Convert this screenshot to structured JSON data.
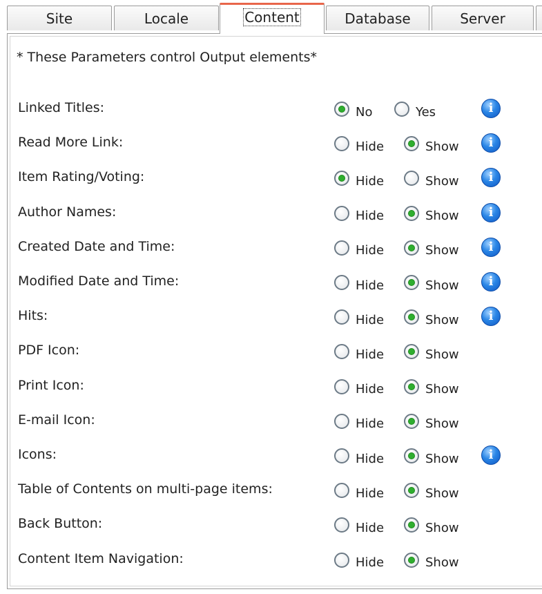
{
  "tabs": [
    "Site",
    "Locale",
    "Content",
    "Database",
    "Server"
  ],
  "intro": "* These Parameters control Output elements*",
  "info_icon_glyph": "i",
  "rows": [
    {
      "label": "Linked Titles:",
      "options": [
        "No",
        "Yes"
      ],
      "selected": 0,
      "info": true
    },
    {
      "label": "Read More Link:",
      "options": [
        "Hide",
        "Show"
      ],
      "selected": 1,
      "info": true
    },
    {
      "label": "Item Rating/Voting:",
      "options": [
        "Hide",
        "Show"
      ],
      "selected": 0,
      "info": true
    },
    {
      "label": "Author Names:",
      "options": [
        "Hide",
        "Show"
      ],
      "selected": 1,
      "info": true
    },
    {
      "label": "Created Date and Time:",
      "options": [
        "Hide",
        "Show"
      ],
      "selected": 1,
      "info": true
    },
    {
      "label": "Modified Date and Time:",
      "options": [
        "Hide",
        "Show"
      ],
      "selected": 1,
      "info": true
    },
    {
      "label": "Hits:",
      "options": [
        "Hide",
        "Show"
      ],
      "selected": 1,
      "info": true
    },
    {
      "label": "PDF Icon:",
      "options": [
        "Hide",
        "Show"
      ],
      "selected": 1,
      "info": false
    },
    {
      "label": "Print Icon:",
      "options": [
        "Hide",
        "Show"
      ],
      "selected": 1,
      "info": false
    },
    {
      "label": "E-mail Icon:",
      "options": [
        "Hide",
        "Show"
      ],
      "selected": 1,
      "info": false
    },
    {
      "label": "Icons:",
      "options": [
        "Hide",
        "Show"
      ],
      "selected": 1,
      "info": true
    },
    {
      "label": "Table of Contents on multi-page items:",
      "options": [
        "Hide",
        "Show"
      ],
      "selected": 1,
      "info": false
    },
    {
      "label": "Back Button:",
      "options": [
        "Hide",
        "Show"
      ],
      "selected": 1,
      "info": false
    },
    {
      "label": "Content Item Navigation:",
      "options": [
        "Hide",
        "Show"
      ],
      "selected": 1,
      "info": false
    }
  ]
}
